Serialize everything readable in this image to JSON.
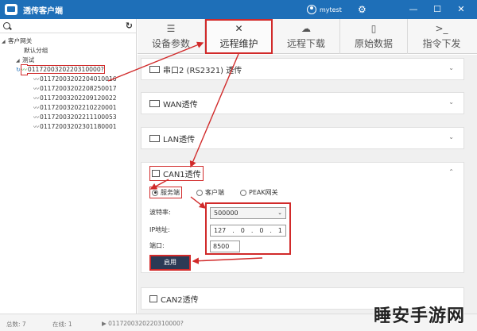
{
  "titlebar": {
    "title": "透传客户端",
    "user": "mytest",
    "minimize": "—",
    "maximize": "☐",
    "close": "✕"
  },
  "sidebar": {
    "search_placeholder": "",
    "tree": {
      "root": "客户网关",
      "default_group": "默认分组",
      "test_group": "测试",
      "devices": [
        "0117200320220310000?",
        "01172003202204010016",
        "01172003202208250017",
        "01172003202209120022",
        "01172003202210220001",
        "01172003202211100053",
        "01172003202301180001"
      ]
    }
  },
  "tabs": [
    {
      "label": "设备参数",
      "icon": "sliders-icon"
    },
    {
      "label": "远程维护",
      "icon": "tools-icon"
    },
    {
      "label": "远程下载",
      "icon": "cloud-download-icon"
    },
    {
      "label": "原始数据",
      "icon": "document-icon"
    },
    {
      "label": "指令下发",
      "icon": "terminal-icon"
    }
  ],
  "panels": {
    "serial2": "串口2 (RS2321) 透传",
    "wan": "WAN透传",
    "lan": "LAN透传",
    "can1": "CAN1透传",
    "can2": "CAN2透传"
  },
  "can1_form": {
    "modes": [
      "服务端",
      "客户端",
      "PEAK网关"
    ],
    "selected_mode": "服务端",
    "baud_label": "波特率:",
    "baud_value": "500000",
    "ip_label": "IP地址:",
    "ip": [
      "127",
      "0",
      "0",
      "1"
    ],
    "port_label": "端口:",
    "port_value": "8500",
    "start_label": "启用"
  },
  "statusbar": {
    "total": "总数: 7",
    "online": "在线: 1",
    "current": "▶ 0117200320220310000?"
  },
  "watermark": "睡安手游网",
  "colors": {
    "title_bar": "#1e6fb8",
    "annotation_red": "#d12a2a",
    "start_button": "#2c3a55",
    "online_green": "#2aa02a"
  }
}
